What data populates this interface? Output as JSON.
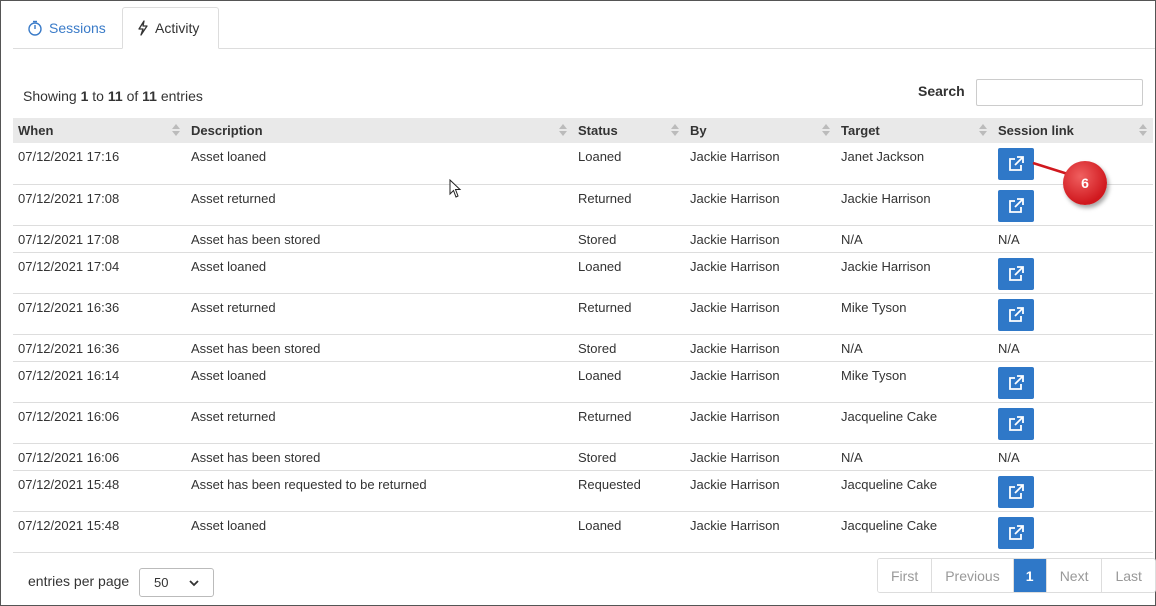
{
  "tabs": [
    {
      "label": "Sessions",
      "icon": "stopwatch-icon"
    },
    {
      "label": "Activity",
      "icon": "lightning-icon"
    }
  ],
  "info": {
    "prefix": "Showing",
    "from": "1",
    "to_word": "to",
    "to": "11",
    "of_word": "of",
    "total": "11",
    "suffix": "entries"
  },
  "search": {
    "label": "Search",
    "value": "",
    "placeholder": ""
  },
  "columns": [
    "When",
    "Description",
    "Status",
    "By",
    "Target",
    "Session link"
  ],
  "rows": [
    {
      "when": "07/12/2021 17:16",
      "description": "Asset loaned",
      "status": "Loaned",
      "by": "Jackie Harrison",
      "target": "Janet Jackson",
      "link": "button"
    },
    {
      "when": "07/12/2021 17:08",
      "description": "Asset returned",
      "status": "Returned",
      "by": "Jackie Harrison",
      "target": "Jackie Harrison",
      "link": "button"
    },
    {
      "when": "07/12/2021 17:08",
      "description": "Asset has been stored",
      "status": "Stored",
      "by": "Jackie Harrison",
      "target": "N/A",
      "link": "N/A"
    },
    {
      "when": "07/12/2021 17:04",
      "description": "Asset loaned",
      "status": "Loaned",
      "by": "Jackie Harrison",
      "target": "Jackie Harrison",
      "link": "button"
    },
    {
      "when": "07/12/2021 16:36",
      "description": "Asset returned",
      "status": "Returned",
      "by": "Jackie Harrison",
      "target": "Mike Tyson",
      "link": "button"
    },
    {
      "when": "07/12/2021 16:36",
      "description": "Asset has been stored",
      "status": "Stored",
      "by": "Jackie Harrison",
      "target": "N/A",
      "link": "N/A"
    },
    {
      "when": "07/12/2021 16:14",
      "description": "Asset loaned",
      "status": "Loaned",
      "by": "Jackie Harrison",
      "target": "Mike Tyson",
      "link": "button"
    },
    {
      "when": "07/12/2021 16:06",
      "description": "Asset returned",
      "status": "Returned",
      "by": "Jackie Harrison",
      "target": "Jacqueline Cake",
      "link": "button"
    },
    {
      "when": "07/12/2021 16:06",
      "description": "Asset has been stored",
      "status": "Stored",
      "by": "Jackie Harrison",
      "target": "N/A",
      "link": "N/A"
    },
    {
      "when": "07/12/2021 15:48",
      "description": "Asset has been requested to be returned",
      "status": "Requested",
      "by": "Jackie Harrison",
      "target": "Jacqueline Cake",
      "link": "button"
    },
    {
      "when": "07/12/2021 15:48",
      "description": "Asset loaned",
      "status": "Loaned",
      "by": "Jackie Harrison",
      "target": "Jacqueline Cake",
      "link": "button"
    }
  ],
  "callout": {
    "label": "6",
    "color": "#d0181e"
  },
  "footer": {
    "entries_label": "entries per page",
    "entries_value": "50",
    "pager": {
      "first": "First",
      "previous": "Previous",
      "current": "1",
      "next": "Next",
      "last": "Last"
    }
  },
  "colors": {
    "accent": "#2f78c8",
    "header_bg": "#e9e9e9"
  }
}
